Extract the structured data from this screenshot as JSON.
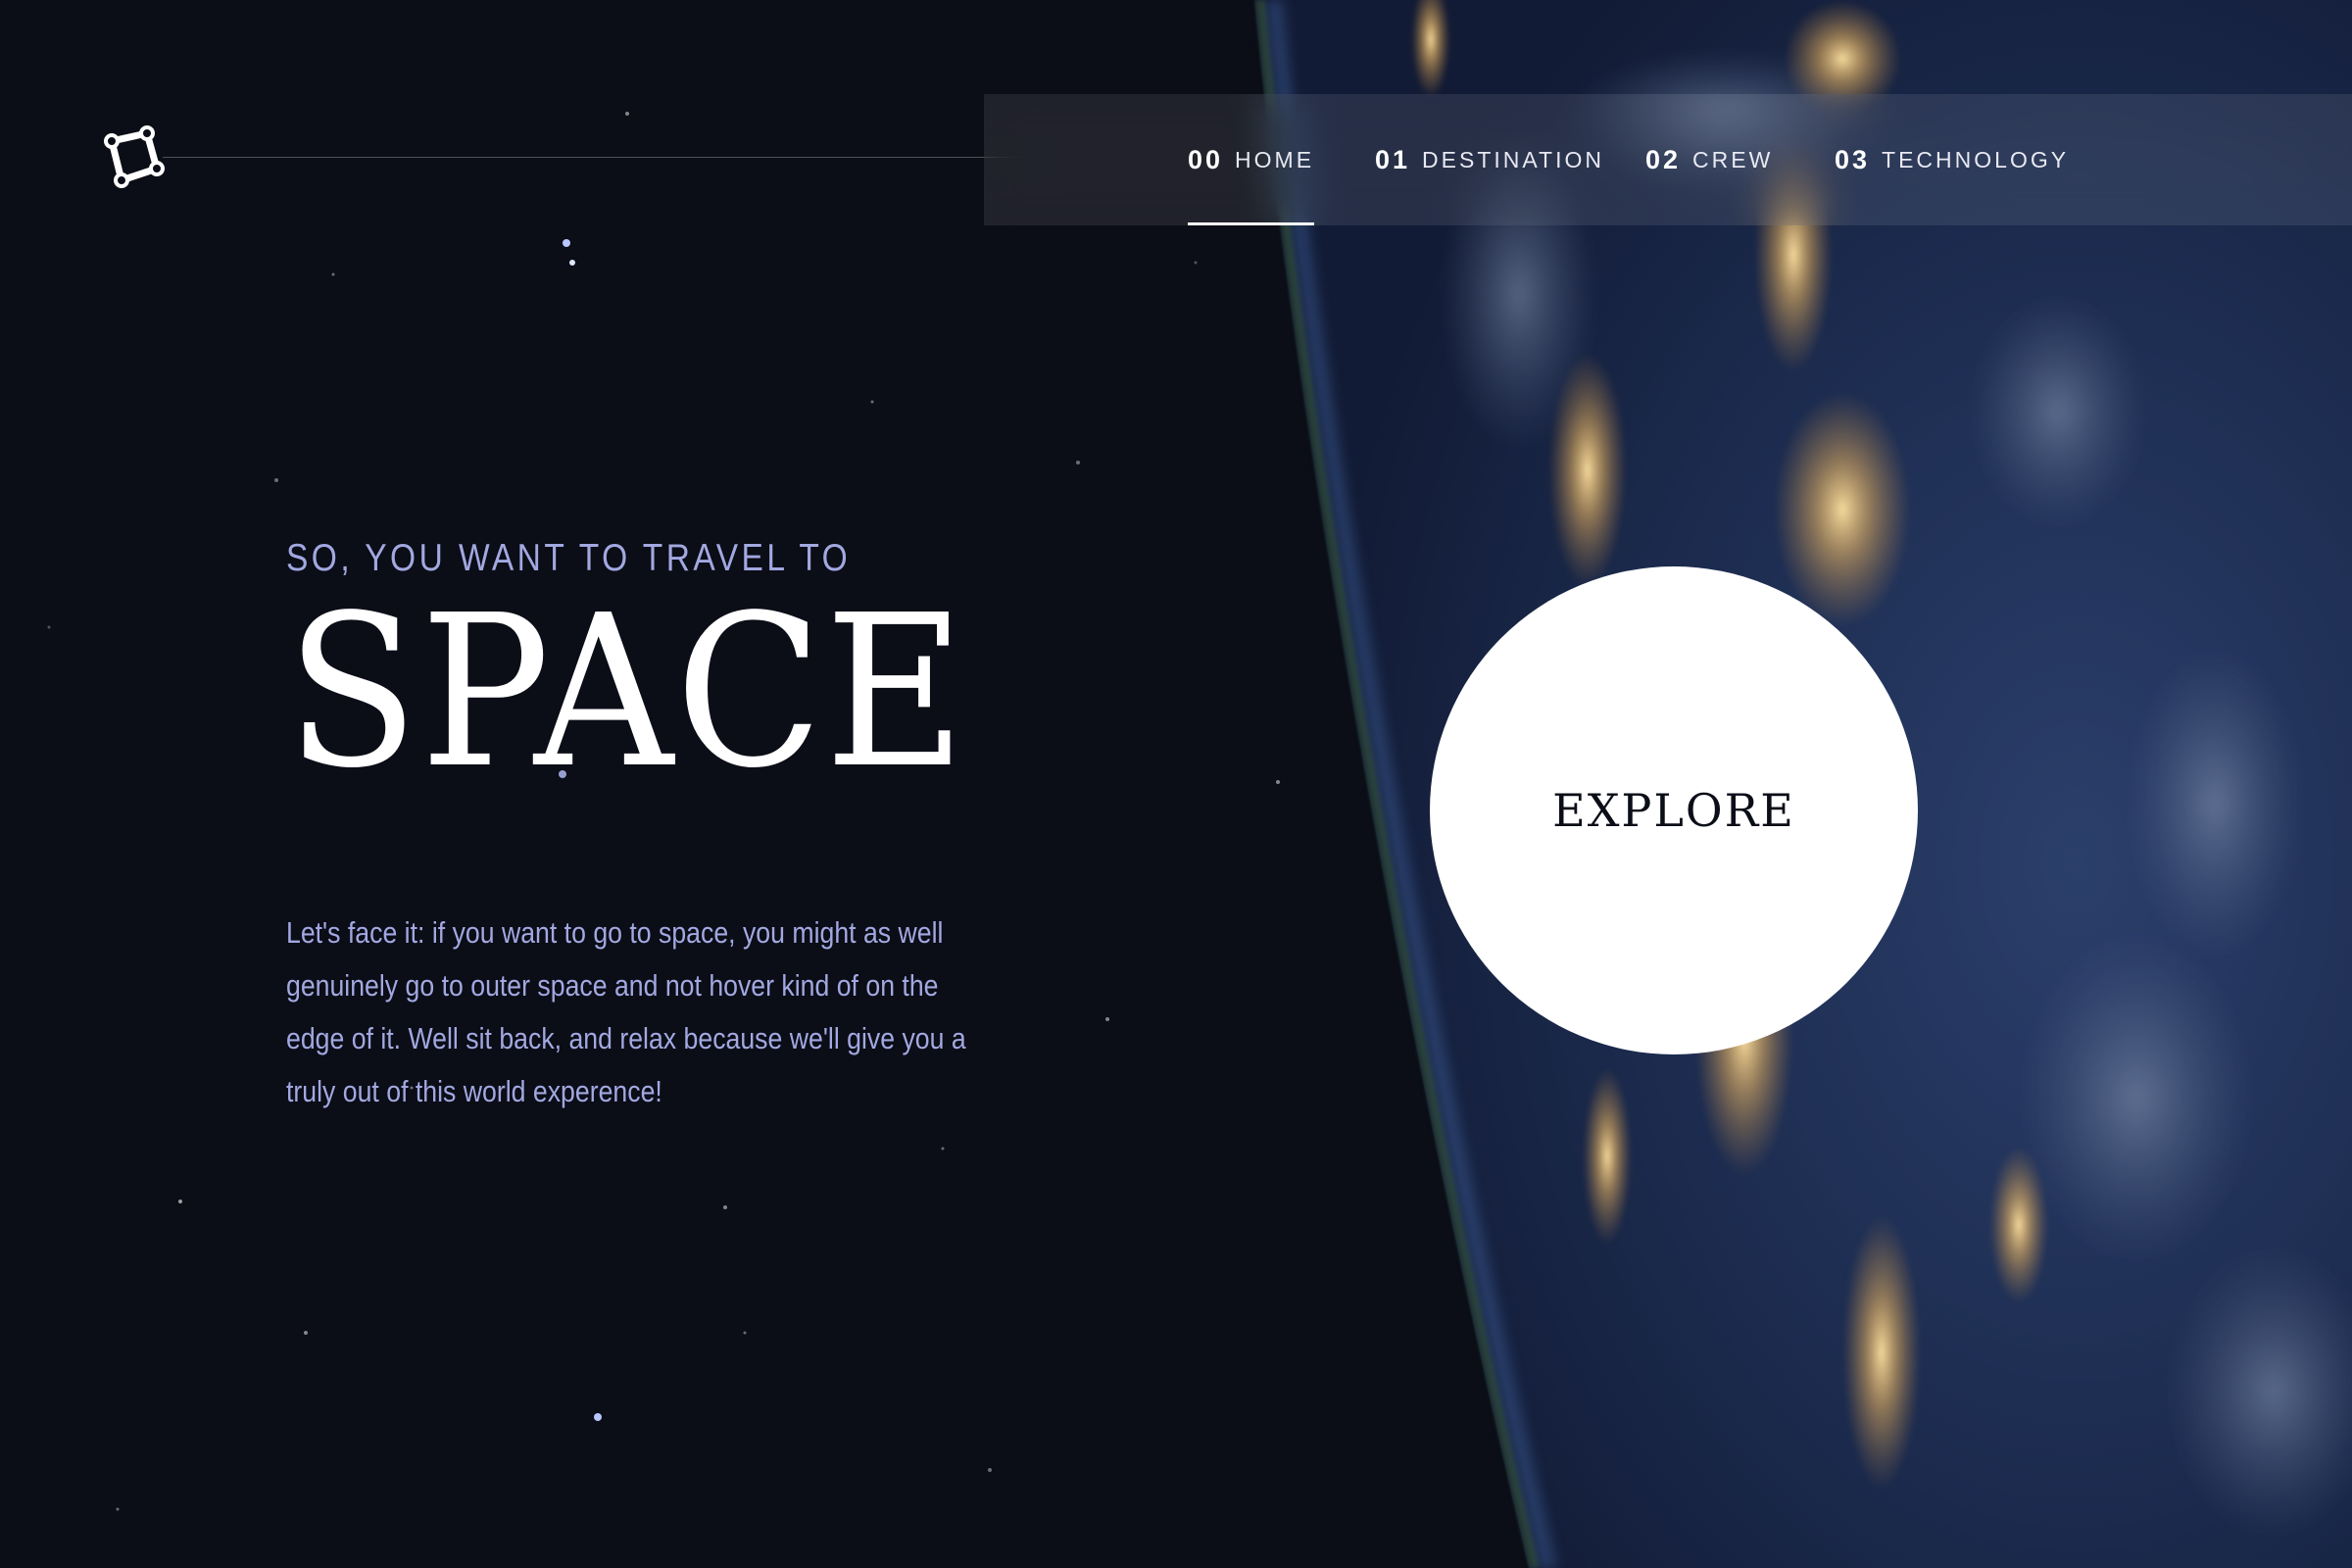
{
  "header": {
    "logo_icon": "star-logo-icon",
    "nav": [
      {
        "num": "00",
        "label": "HOME",
        "active": true
      },
      {
        "num": "01",
        "label": "DESTINATION",
        "active": false
      },
      {
        "num": "02",
        "label": "CREW",
        "active": false
      },
      {
        "num": "03",
        "label": "TECHNOLOGY",
        "active": false
      }
    ]
  },
  "hero": {
    "eyebrow": "SO, YOU WANT TO TRAVEL TO",
    "title": "SPACE",
    "body": "Let's face it: if you want to go to space, you might as well genuinely go to outer space and not hover kind of on the edge of it. Well sit back, and relax because we'll give you a truly out of this world experence!",
    "explore_label": "EXPLORE"
  },
  "colors": {
    "background": "#0b0d17",
    "accent_text": "#a2a8e0",
    "white": "#ffffff"
  }
}
